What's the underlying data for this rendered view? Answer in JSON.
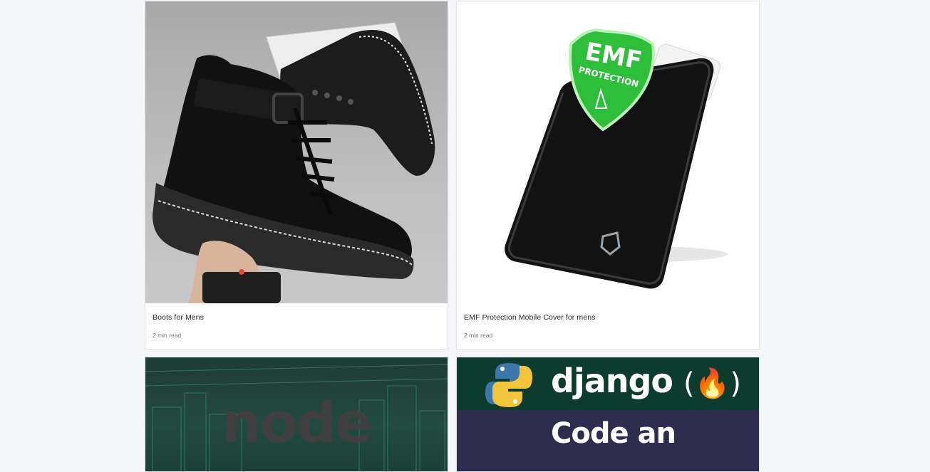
{
  "cards": [
    {
      "title": "Boots for Mens",
      "meta": "2 min read",
      "image_alt": "Black leather boots"
    },
    {
      "title": "EMF Protection Mobile Cover for mens",
      "meta": "2 min read",
      "image_alt": "EMF protection phone pouch",
      "image_badge_line1": "EMF",
      "image_badge_line2": "PROTECTION"
    },
    {
      "image_alt": "Node.js banner",
      "image_word": "node"
    },
    {
      "image_alt": "Django course banner",
      "image_word": "django",
      "image_subtitle": "Code an"
    }
  ]
}
